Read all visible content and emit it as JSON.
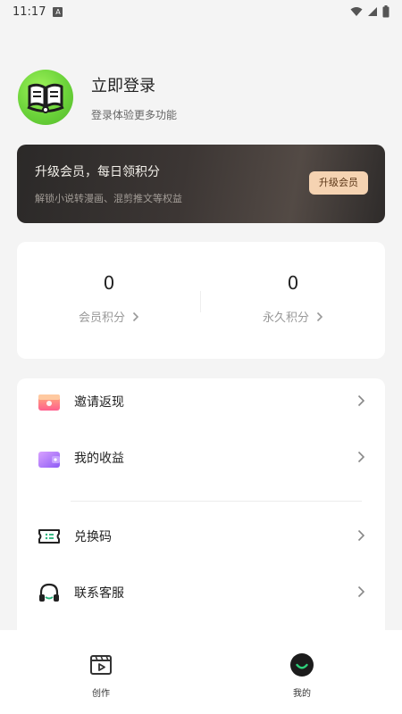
{
  "status": {
    "time": "11:17",
    "notif": "A"
  },
  "profile": {
    "title": "立即登录",
    "subtitle": "登录体验更多功能",
    "avatar_icon": "book-logo-icon"
  },
  "vip": {
    "title": "升级会员，每日领积分",
    "desc": "解锁小说转漫画、混剪推文等权益",
    "button": "升级会员"
  },
  "points": {
    "left": {
      "value": "0",
      "label": "会员积分"
    },
    "right": {
      "value": "0",
      "label": "永久积分"
    }
  },
  "menu": {
    "items": [
      {
        "label": "邀请返现",
        "icon": "invite-gift-icon"
      },
      {
        "label": "我的收益",
        "icon": "wallet-icon"
      },
      {
        "label": "兑换码",
        "icon": "redeem-code-icon"
      },
      {
        "label": "联系客服",
        "icon": "headphones-icon"
      }
    ]
  },
  "nav": {
    "items": [
      {
        "label": "创作",
        "icon": "create-icon"
      },
      {
        "label": "我的",
        "icon": "smile-avatar-icon"
      }
    ]
  },
  "colors": {
    "accent_green": "#6bd33a",
    "vip_button": "#f5d3b2",
    "vip_card": "#3c3634"
  }
}
